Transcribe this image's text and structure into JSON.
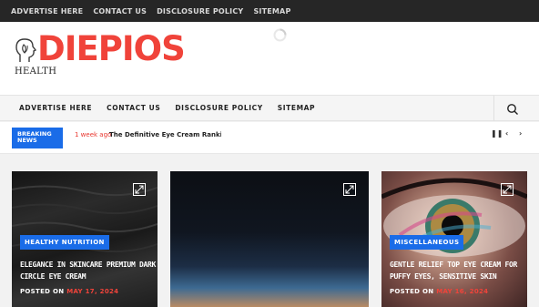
{
  "topbar": {
    "links": [
      "ADVERTISE HERE",
      "CONTACT US",
      "DISCLOSURE POLICY",
      "SITEMAP"
    ]
  },
  "header": {
    "logo_text": "DIEPIOS",
    "logo_sub": "HEALTH",
    "brand_color": "#f0433a"
  },
  "nav": {
    "links": [
      "ADVERTISE HERE",
      "CONTACT US",
      "DISCLOSURE POLICY",
      "SITEMAP"
    ],
    "search_icon": "search-icon"
  },
  "breaking": {
    "badge": "BREAKING NEWS",
    "time": "1 week ago",
    "title": "The Definitive Eye Cream Ranking Disco",
    "controls": [
      "pause-icon",
      "chevron-left-icon",
      "chevron-right-icon"
    ]
  },
  "cards": [
    {
      "category": "HEALTHY NUTRITION",
      "title": "ELEGANCE IN SKINCARE PREMIUM DARK CIRCLE EYE CREAM",
      "posted": "POSTED ON",
      "date": "MAY 17, 2024"
    },
    {
      "category": "",
      "title": "",
      "posted": "",
      "date": ""
    },
    {
      "category": "MISCELLANEOUS",
      "title": "GENTLE RELIEF TOP EYE CREAM FOR PUFFY EYES, SENSITIVE SKIN",
      "posted": "POSTED ON",
      "date": "MAY 16, 2024"
    }
  ],
  "colors": {
    "accent": "#1a6ce8",
    "topbar": "#262626",
    "date": "#f0433a"
  }
}
